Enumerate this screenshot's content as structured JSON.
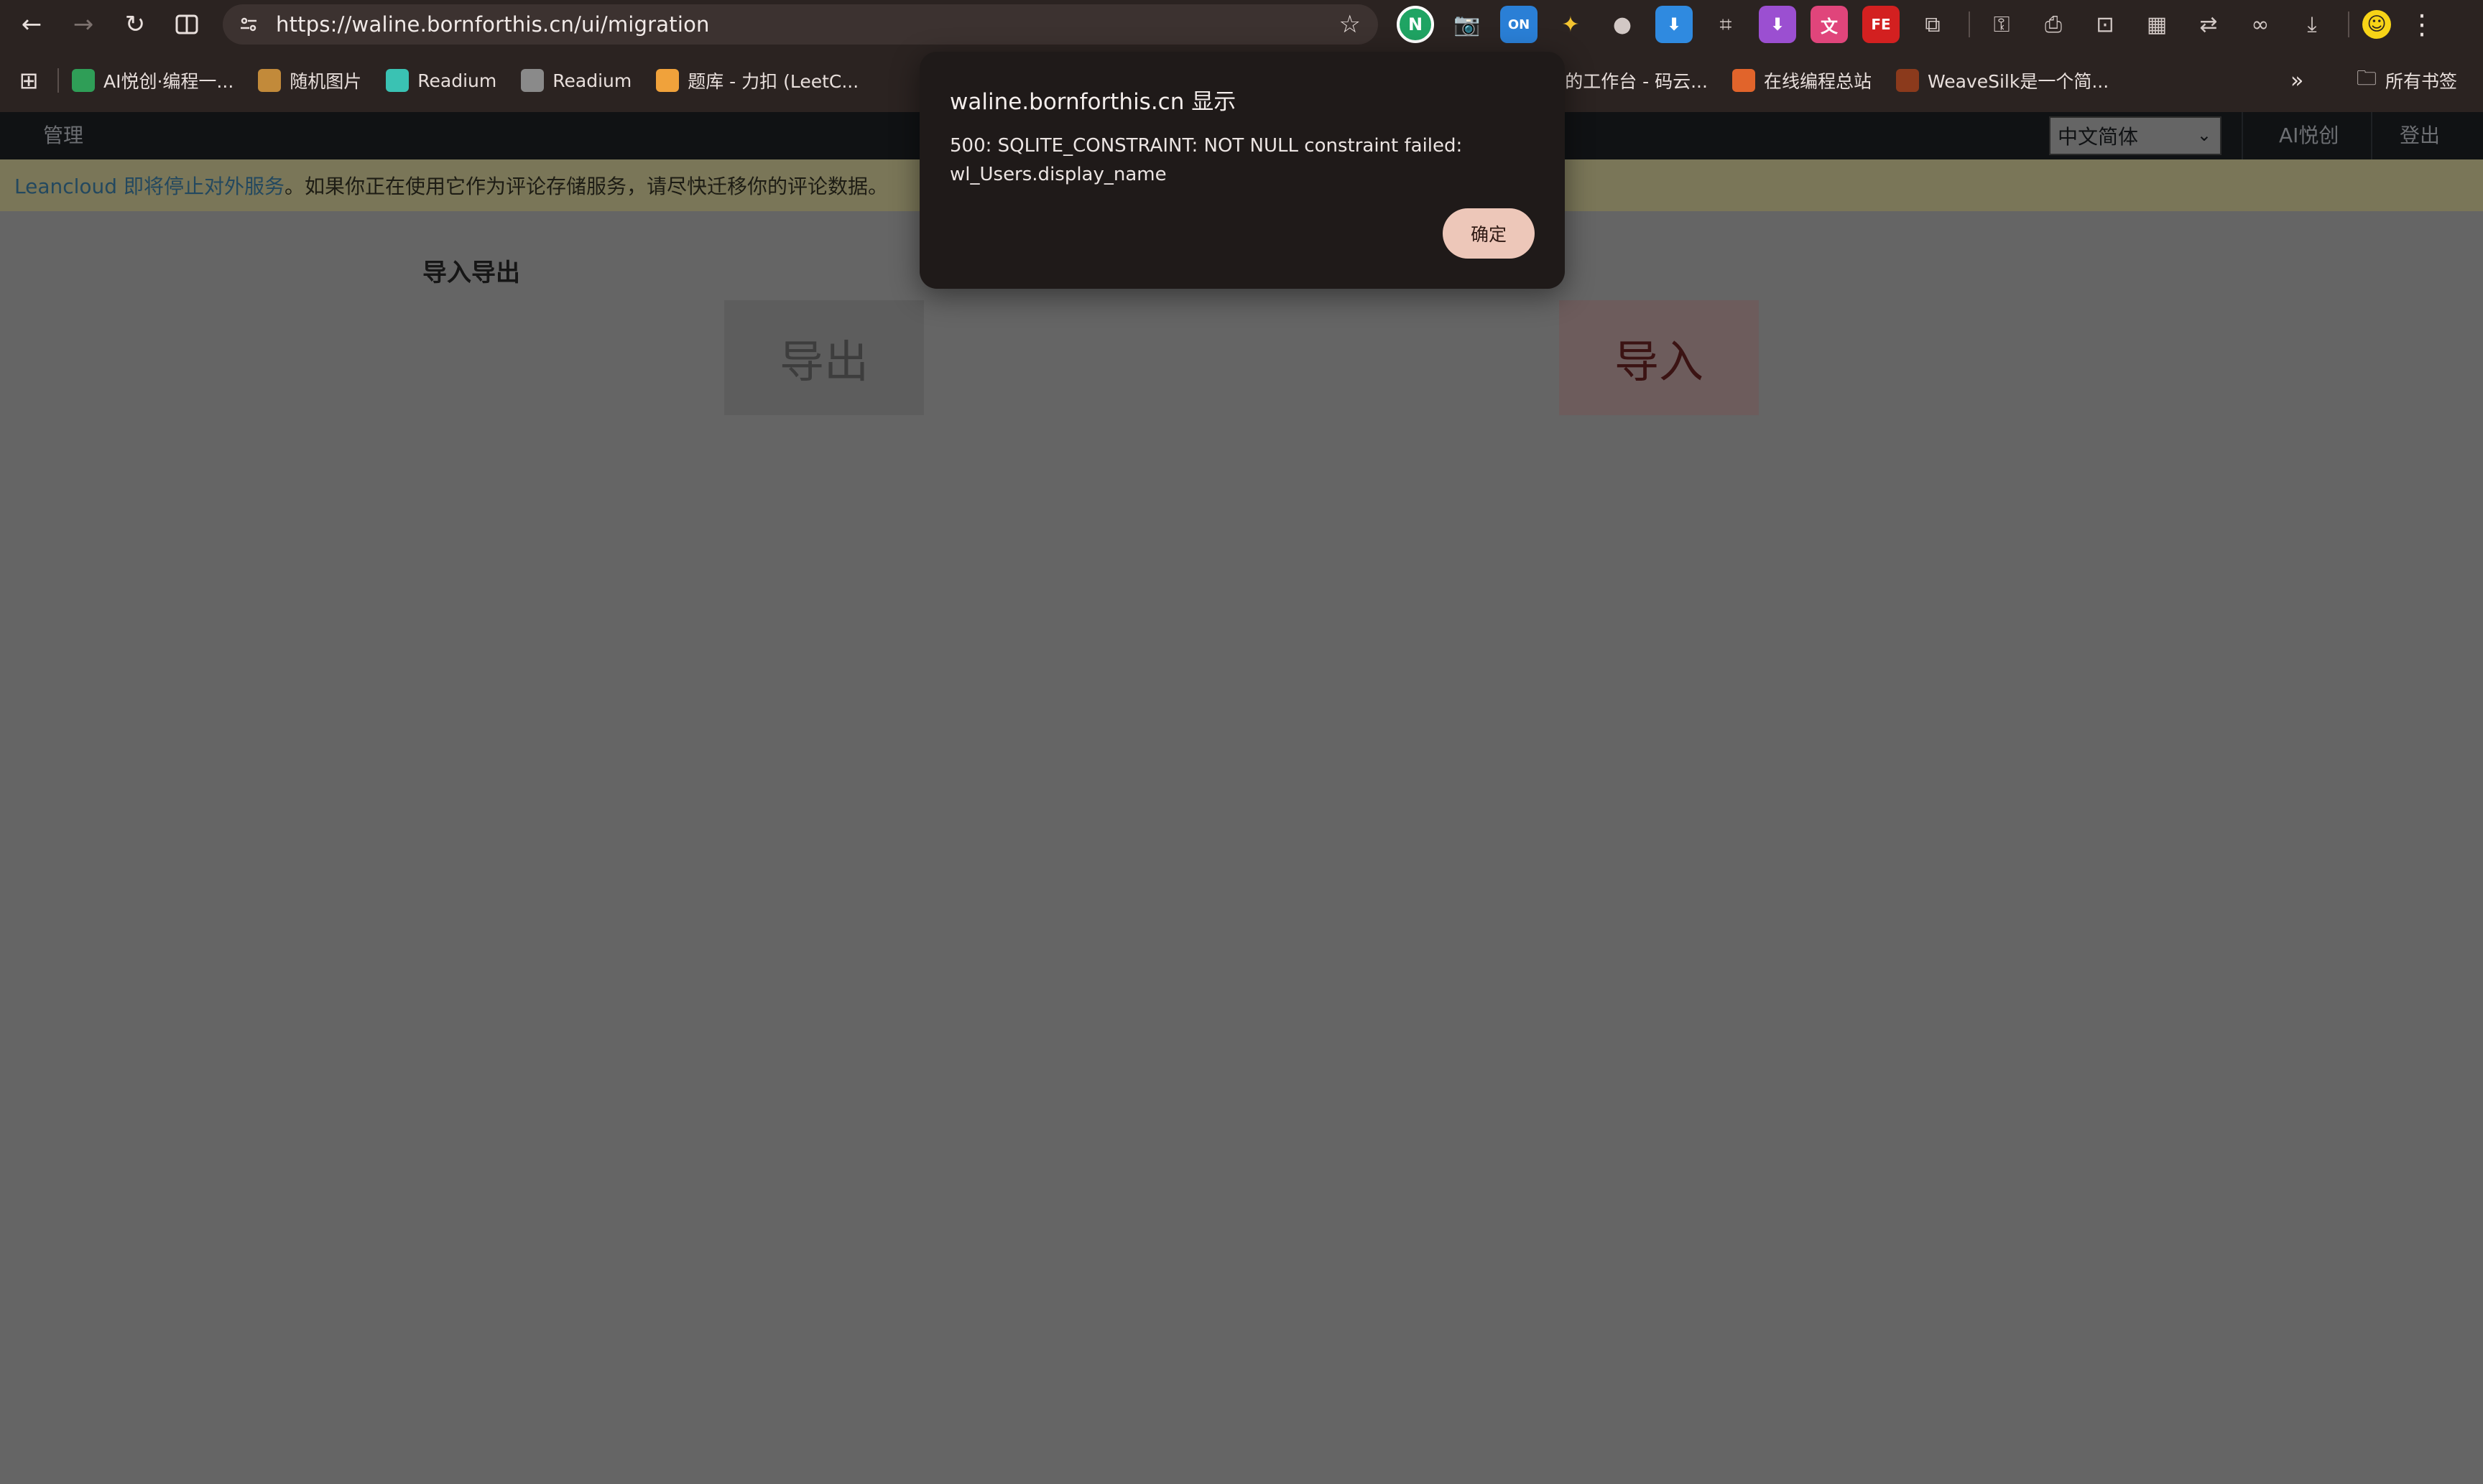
{
  "browser": {
    "url": "https://waline.bornforthis.cn/ui/migration",
    "bookmarks": [
      {
        "label": "AI悦创·编程一...",
        "icon": "bookmark-ai-icon",
        "color": "#2f9e57"
      },
      {
        "label": "随机图片",
        "icon": "bookmark-box-icon",
        "color": "#c28a3a"
      },
      {
        "label": "Readium",
        "icon": "bookmark-readium-icon",
        "color": "#3ac2b3"
      },
      {
        "label": "Readium",
        "icon": "bookmark-globe-icon",
        "color": "#8a8a8a"
      },
      {
        "label": "题库 - 力扣 (LeetC...",
        "icon": "bookmark-leetcode-icon",
        "color": "#f0a23b"
      },
      {
        "label": "我的工作台 - 码云...",
        "icon": "bookmark-gitee-icon",
        "color": "#c71d23"
      },
      {
        "label": "在线编程总站",
        "icon": "bookmark-code-icon",
        "color": "#e1642b"
      },
      {
        "label": "WeaveSilk是一个简...",
        "icon": "bookmark-weavesilk-icon",
        "color": "#8b3a1c"
      }
    ],
    "all_bookmarks": "所有书签"
  },
  "page": {
    "nav_admin": "管理",
    "language": "中文简体",
    "nav_ai": "AI悦创",
    "nav_logout": "登出",
    "notice_link": "Leancloud 即将停止对外服务",
    "notice_text": "。如果你正在使用它作为评论存储服务，请尽快迁移你的评论数据。",
    "section_title": "导入导出",
    "export_label": "导出",
    "import_label": "导入"
  },
  "dialog": {
    "title": "waline.bornforthis.cn 显示",
    "message": "500: SQLITE_CONSTRAINT: NOT NULL constraint failed: wl_Users.display_name",
    "ok_label": "确定"
  }
}
